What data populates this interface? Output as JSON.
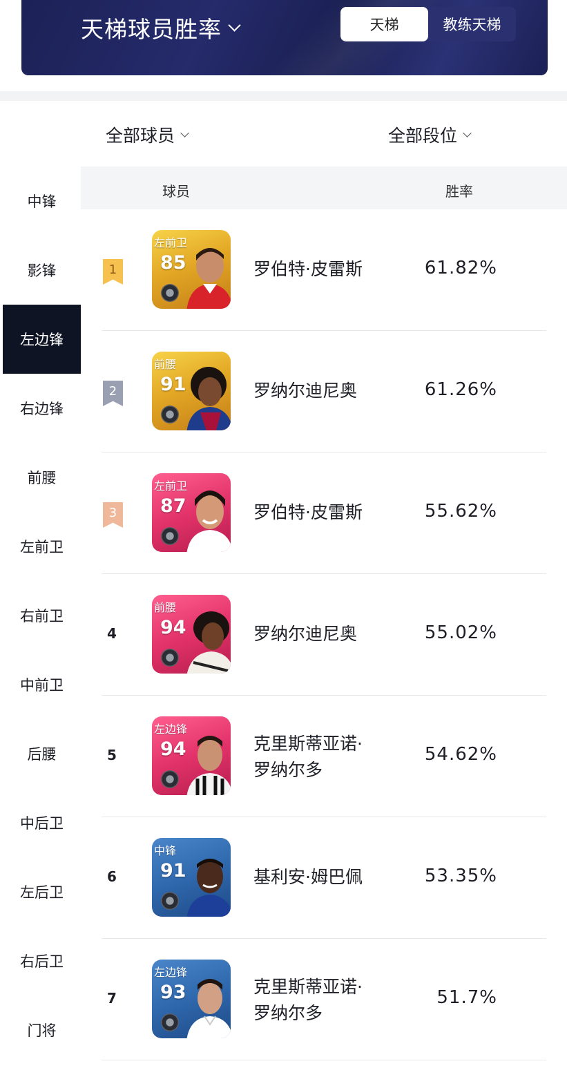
{
  "header": {
    "title": "天梯球员胜率",
    "segments": [
      {
        "label": "天梯",
        "active": true
      },
      {
        "label": "教练天梯",
        "active": false
      }
    ]
  },
  "filters": {
    "players": "全部球员",
    "tiers": "全部段位"
  },
  "sidebar": {
    "items": [
      "中锋",
      "影锋",
      "左边锋",
      "右边锋",
      "前腰",
      "左前卫",
      "右前卫",
      "中前卫",
      "后腰",
      "中后卫",
      "左后卫",
      "右后卫",
      "门将"
    ],
    "active_index": 2
  },
  "table": {
    "columns": [
      "球员",
      "胜率"
    ],
    "rows": [
      {
        "rank": "1",
        "position": "左前卫",
        "rating": "85",
        "card_color": "gold",
        "name_lines": [
          "罗伯特·皮雷斯"
        ],
        "win_rate": "61.82%"
      },
      {
        "rank": "2",
        "position": "前腰",
        "rating": "91",
        "card_color": "gold",
        "name_lines": [
          "罗纳尔迪尼奥"
        ],
        "win_rate": "61.26%"
      },
      {
        "rank": "3",
        "position": "左前卫",
        "rating": "87",
        "card_color": "pink",
        "name_lines": [
          "罗伯特·皮雷斯"
        ],
        "win_rate": "55.62%"
      },
      {
        "rank": "4",
        "position": "前腰",
        "rating": "94",
        "card_color": "pink",
        "name_lines": [
          "罗纳尔迪尼奥"
        ],
        "win_rate": "55.02%"
      },
      {
        "rank": "5",
        "position": "左边锋",
        "rating": "94",
        "card_color": "pink",
        "name_lines": [
          "克里斯蒂亚诺·",
          "罗纳尔多"
        ],
        "win_rate": "54.62%"
      },
      {
        "rank": "6",
        "position": "中锋",
        "rating": "91",
        "card_color": "blue",
        "name_lines": [
          "基利安·姆巴佩"
        ],
        "win_rate": "53.35%"
      },
      {
        "rank": "7",
        "position": "左边锋",
        "rating": "93",
        "card_color": "blue",
        "name_lines": [
          "克里斯蒂亚诺·",
          "罗纳尔多"
        ],
        "win_rate": "51.7%"
      }
    ]
  },
  "colors": {
    "banner": "#1c2156",
    "sidebar_active": "#0f1424",
    "rank_gold": "#f6c14e",
    "rank_silver": "#9aa0b2",
    "rank_bronze": "#f0b89a"
  }
}
